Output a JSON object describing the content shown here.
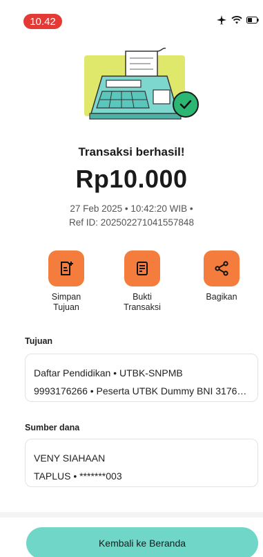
{
  "status_bar": {
    "time": "10.42",
    "icons": [
      "airplane-icon",
      "wifi-icon",
      "battery-icon"
    ],
    "time_pill_color": "#e53935"
  },
  "hero": {
    "illustration": "cash-register-with-checkmark"
  },
  "result": {
    "title": "Transaksi berhasil!",
    "amount": "Rp10.000",
    "datetime": "27 Feb 2025 • 10:42:20 WIB •",
    "ref": "Ref ID: 202502271041557848"
  },
  "actions": [
    {
      "label": "Simpan\nTujuan",
      "icon": "save-destination-icon"
    },
    {
      "label": "Bukti\nTransaksi",
      "icon": "receipt-icon"
    },
    {
      "label": "Bagikan",
      "icon": "share-icon"
    }
  ],
  "destination": {
    "heading": "Tujuan",
    "line1": "Daftar Pendidikan • UTBK-SNPMB",
    "line2": "9993176266 • Peserta UTBK Dummy BNI 31762..."
  },
  "source": {
    "heading": "Sumber dana",
    "line1": "VENY SIAHAAN",
    "line2": "TAPLUS • *******003"
  },
  "footer": {
    "home_label": "Kembali ke Beranda"
  },
  "colors": {
    "accent_orange": "#f47c3c",
    "button_teal": "#6fd6c8",
    "success_green": "#2bb673"
  }
}
